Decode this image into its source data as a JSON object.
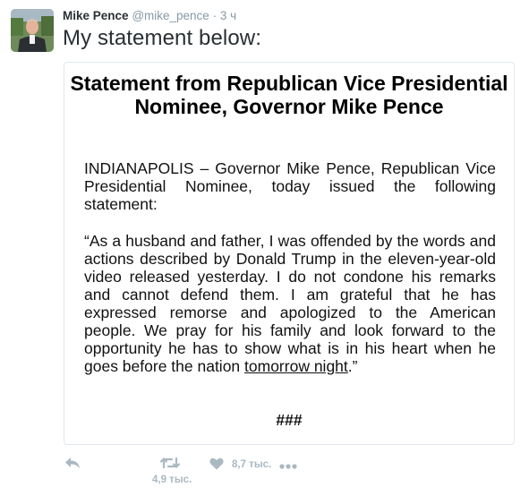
{
  "tweet": {
    "author_name": "Mike Pence",
    "author_handle": "@mike_pence",
    "separator": "·",
    "timestamp": "3 ч",
    "text": "My statement below:"
  },
  "statement": {
    "title": "Statement from Republican Vice Presidential Nominee, Governor Mike Pence",
    "intro": "INDIANAPOLIS – Governor Mike Pence, Republican Vice Presidential Nominee, today issued the following statement:",
    "quote_before": "“As a husband and father, I was offended by the words and actions described by Donald Trump in the eleven-year-old video released yesterday. I do not condone his remarks and cannot defend them. I am grateful that he has expressed remorse and apologized to the American people. We pray for his family and look forward to the opportunity he has to show what is in his heart when he goes before the nation ",
    "quote_underlined": "tomorrow night",
    "quote_after": ".”",
    "end_mark": "###"
  },
  "actions": {
    "reply_icon": "reply-icon",
    "retweet_icon": "retweet-icon",
    "retweet_count": "4,9 тыс.",
    "like_icon": "heart-icon",
    "like_count": "8,7 тыс.",
    "more_icon": "more-icon"
  },
  "colors": {
    "text": "#292f33",
    "muted": "#8899a6",
    "icon": "#aab8c2",
    "border": "#e1e8ed"
  }
}
